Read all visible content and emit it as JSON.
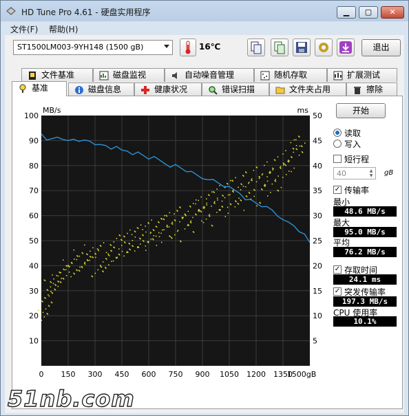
{
  "window": {
    "title": "HD Tune Pro 4.61 - 硬盘实用程序"
  },
  "menu": {
    "file": "文件(F)",
    "help": "帮助(H)"
  },
  "toolbar": {
    "drive": "ST1500LM003-9YH148      (1500 gB)",
    "temperature": "16℃",
    "exit_label": "退出",
    "tool_icons": [
      "copy-info-icon",
      "copy-screenshot-icon",
      "save-icon",
      "options-icon",
      "download-icon"
    ]
  },
  "tabs_row1": [
    "文件基准",
    "磁盘监视",
    "自动噪音管理",
    "随机存取",
    "扩展测试"
  ],
  "tabs_row2": [
    "基准",
    "磁盘信息",
    "健康状况",
    "错误扫描",
    "文件夹占用",
    "擦除"
  ],
  "sidebar": {
    "start_label": "开始",
    "read_label": "读取",
    "write_label": "写入",
    "short_stroke_label": "短行程",
    "short_stroke_value": "40",
    "short_stroke_unit": "gB",
    "transfer_label": "传输率",
    "min_label": "最小",
    "min_value": "48.6 MB/s",
    "max_label": "最大",
    "max_value": "95.0 MB/s",
    "avg_label": "平均",
    "avg_value": "76.2 MB/s",
    "access_label": "存取时间",
    "access_value": "24.1 ms",
    "burst_label": "突发传输率",
    "burst_value": "197.3 MB/s",
    "cpu_label": "CPU 使用率",
    "cpu_value": "10.1%"
  },
  "chart_data": {
    "type": "line",
    "left_unit": "MB/s",
    "right_unit": "ms",
    "x_ticks": [
      "0",
      "150",
      "300",
      "450",
      "600",
      "750",
      "900",
      "1050",
      "1200",
      "1350",
      "1500gB"
    ],
    "y_left_ticks": [
      10,
      20,
      30,
      40,
      50,
      60,
      70,
      80,
      90,
      100
    ],
    "y_right_ticks": [
      5,
      10,
      15,
      20,
      25,
      30,
      35,
      40,
      45,
      50
    ],
    "xlim": [
      0,
      1500
    ],
    "ylim_left": [
      0,
      100
    ],
    "ylim_right": [
      0,
      50
    ],
    "series": [
      {
        "axis": "left",
        "color": "#2b93d6",
        "x": [
          0,
          30,
          60,
          90,
          120,
          150,
          180,
          210,
          240,
          270,
          300,
          330,
          360,
          390,
          420,
          450,
          480,
          510,
          540,
          570,
          600,
          630,
          660,
          690,
          720,
          750,
          780,
          810,
          840,
          870,
          900,
          930,
          960,
          990,
          1020,
          1050,
          1080,
          1110,
          1140,
          1170,
          1200,
          1230,
          1260,
          1290,
          1320,
          1350,
          1380,
          1410,
          1440,
          1470,
          1500
        ],
        "values": [
          92,
          90,
          91,
          92,
          90,
          90,
          91,
          89,
          90,
          90,
          89,
          88,
          88,
          87,
          87,
          86,
          86,
          85,
          85,
          84,
          83,
          83,
          82,
          81,
          80,
          80,
          79,
          78,
          77,
          76,
          75,
          75,
          74,
          73,
          72,
          71,
          70,
          69,
          67,
          66,
          65,
          64,
          63,
          62,
          60,
          59,
          57,
          56,
          54,
          52,
          49
        ]
      },
      {
        "axis": "right",
        "type": "scatter",
        "color": "#e8e33a",
        "x": [
          10,
          20,
          30,
          45,
          60,
          75,
          90,
          110,
          130,
          150,
          170,
          190,
          210,
          230,
          250,
          270,
          290,
          310,
          330,
          350,
          370,
          390,
          410,
          430,
          450,
          470,
          490,
          510,
          530,
          550,
          570,
          590,
          610,
          630,
          650,
          670,
          690,
          710,
          730,
          750,
          770,
          790,
          810,
          830,
          850,
          870,
          890,
          910,
          930,
          950,
          970,
          990,
          1010,
          1030,
          1050,
          1070,
          1090,
          1110,
          1130,
          1150,
          1170,
          1190,
          1210,
          1230,
          1250,
          1270,
          1290,
          1310,
          1330,
          1350,
          1370,
          1390,
          1410,
          1430,
          1450
        ],
        "values": [
          10,
          14,
          12,
          16,
          15,
          18,
          17,
          19,
          18,
          20,
          21,
          19,
          22,
          20,
          21,
          23,
          22,
          19,
          24,
          21,
          20,
          23,
          25,
          22,
          24,
          26,
          23,
          25,
          27,
          24,
          26,
          28,
          25,
          27,
          26,
          29,
          27,
          30,
          28,
          26,
          31,
          29,
          30,
          28,
          32,
          30,
          33,
          31,
          29,
          34,
          32,
          35,
          31,
          33,
          36,
          34,
          37,
          32,
          35,
          38,
          36,
          33,
          39,
          37,
          35,
          40,
          38,
          36,
          41,
          39,
          42,
          40,
          44,
          43,
          45
        ]
      }
    ]
  },
  "watermark": "51nb.com"
}
